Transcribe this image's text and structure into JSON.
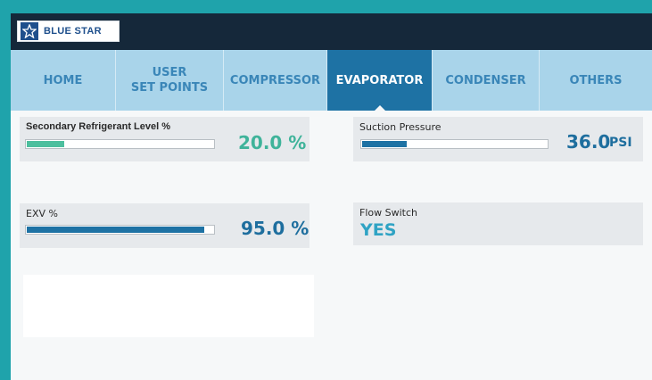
{
  "brand": {
    "name": "BLUE STAR",
    "icon": "star-icon"
  },
  "nav": {
    "tabs": [
      {
        "label": "HOME",
        "active": false
      },
      {
        "label": "USER\nSET POINTS",
        "active": false
      },
      {
        "label": "COMPRESSOR",
        "active": false
      },
      {
        "label": "EVAPORATOR",
        "active": true
      },
      {
        "label": "CONDENSER",
        "active": false
      },
      {
        "label": "OTHERS",
        "active": false
      }
    ]
  },
  "readings": {
    "secondary_refrigerant": {
      "label": "Secondary Refrigerant Level %",
      "value": "20.0 %",
      "level": 0.2,
      "color": "#4dbf9e"
    },
    "suction_pressure": {
      "label": "Suction Pressure",
      "value": "36.0",
      "unit": "PSI",
      "level": 0.24,
      "color": "#1e72a4"
    },
    "exv": {
      "label": "EXV %",
      "value": "95.0 %",
      "level": 0.95,
      "color": "#1e72a4"
    },
    "flow_switch": {
      "label": "Flow Switch",
      "value": "YES"
    }
  },
  "colors": {
    "accent": "#1e72a4",
    "nav_bg": "#a9d4ea",
    "topbar": "#15283a",
    "frame": "#1fa3ab"
  }
}
